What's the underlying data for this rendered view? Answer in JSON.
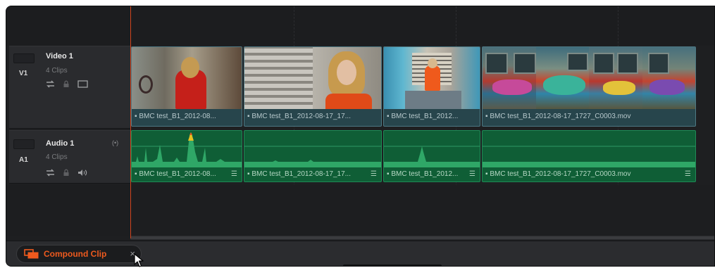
{
  "video_track": {
    "id": "V1",
    "name": "Video 1",
    "clip_count": "4 Clips",
    "icons": [
      "link-icon",
      "lock-icon",
      "monitor-icon"
    ],
    "clips": [
      {
        "label": "▪ BMC test_B1_2012-08..."
      },
      {
        "label": "▪ BMC test_B1_2012-08-17_17..."
      },
      {
        "label": "▪ BMC test_B1_2012..."
      },
      {
        "label": "▪ BMC test_B1_2012-08-17_1727_C0003.mov"
      }
    ]
  },
  "audio_track": {
    "id": "A1",
    "name": "Audio 1",
    "clip_count": "4 Clips",
    "mute_label": "(•)",
    "icons": [
      "link-icon",
      "lock-icon",
      "speaker-icon"
    ],
    "clips": [
      {
        "label": "▪ BMC test_B1_2012-08..."
      },
      {
        "label": "▪ BMC test_B1_2012-08-17_17..."
      },
      {
        "label": "▪ BMC test_B1_2012..."
      },
      {
        "label": "▪ BMC test_B1_2012-08-17_1727_C0003.mov"
      }
    ]
  },
  "tab_bar": {
    "tab_label": "Compound Clip",
    "close_glyph": "×"
  },
  "colors": {
    "accent": "#ee5a1e",
    "video_clip": "#27454c",
    "audio_clip": "#0f5e36",
    "playhead": "#d0441e"
  }
}
